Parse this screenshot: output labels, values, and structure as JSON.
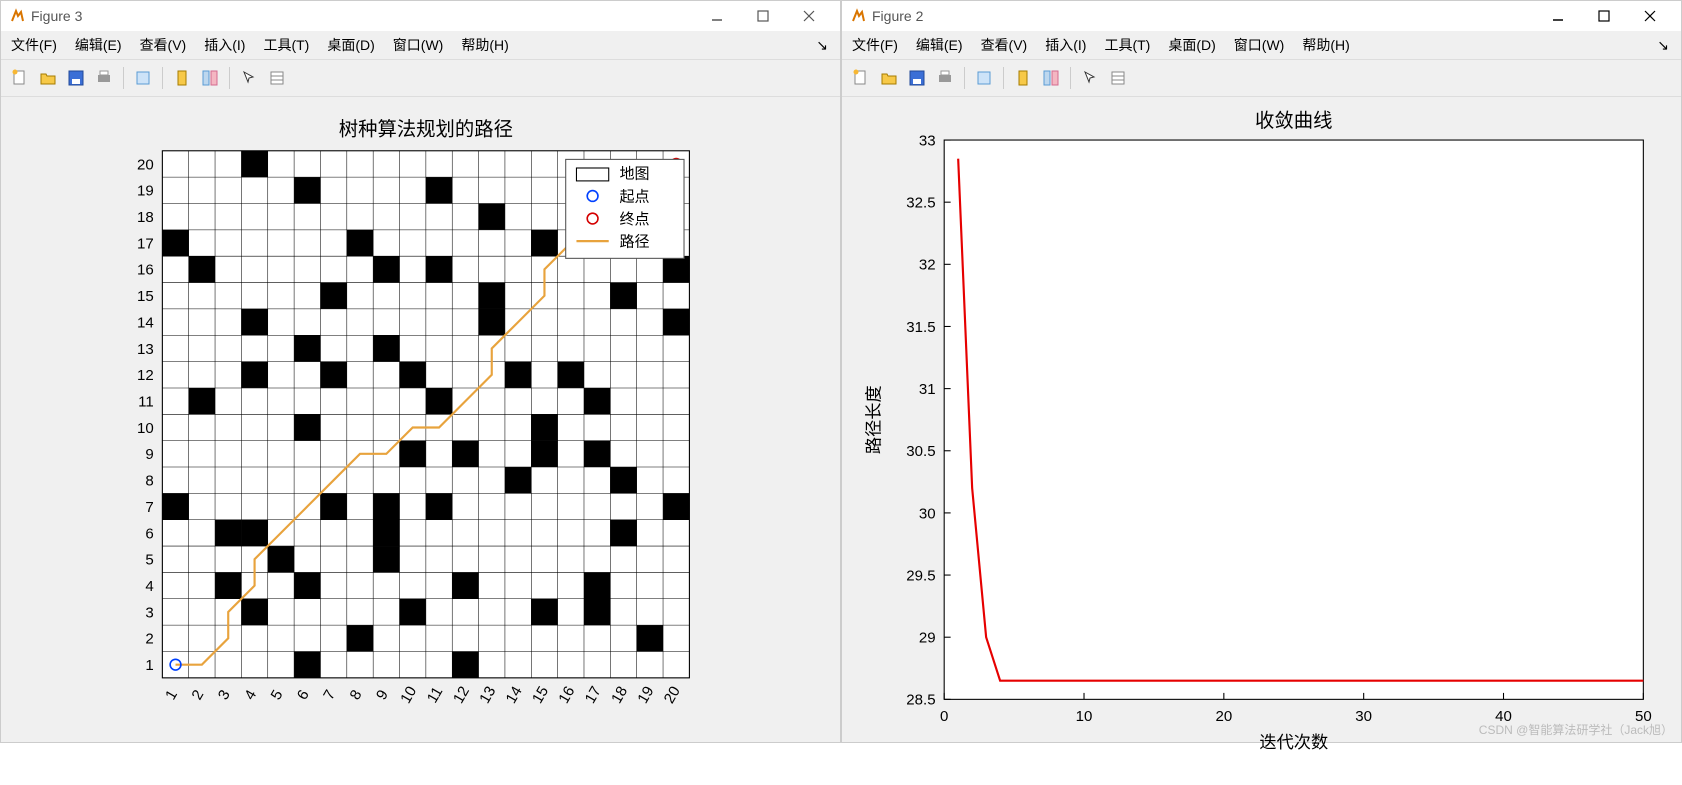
{
  "windows": [
    {
      "title": "Figure 3"
    },
    {
      "title": "Figure 2"
    }
  ],
  "menu": [
    "文件(F)",
    "编辑(E)",
    "查看(V)",
    "插入(I)",
    "工具(T)",
    "桌面(D)",
    "窗口(W)",
    "帮助(H)"
  ],
  "left": {
    "title": "树种算法规划的路径",
    "legend": [
      "地图",
      "起点",
      "终点",
      "路径"
    ],
    "xticks": [
      1,
      2,
      3,
      4,
      5,
      6,
      7,
      8,
      9,
      10,
      11,
      12,
      13,
      14,
      15,
      16,
      17,
      18,
      19,
      20
    ],
    "yticks": [
      1,
      2,
      3,
      4,
      5,
      6,
      7,
      8,
      9,
      10,
      11,
      12,
      13,
      14,
      15,
      16,
      17,
      18,
      19,
      20
    ]
  },
  "right": {
    "title": "收敛曲线",
    "xlabel": "迭代次数",
    "ylabel": "路径长度",
    "xticks": [
      0,
      10,
      20,
      30,
      40,
      50
    ],
    "yticks": [
      28.5,
      29,
      29.5,
      30,
      30.5,
      31,
      31.5,
      32,
      32.5,
      33
    ]
  },
  "watermark": "CSDN @智能算法研学社（Jack旭）",
  "chart_data": [
    {
      "type": "heatmap",
      "title": "树种算法规划的路径",
      "xlim": [
        0.5,
        20.5
      ],
      "ylim": [
        0.5,
        20.5
      ],
      "obstacles": [
        [
          1,
          7
        ],
        [
          1,
          17
        ],
        [
          2,
          11
        ],
        [
          2,
          16
        ],
        [
          3,
          4
        ],
        [
          3,
          6
        ],
        [
          4,
          3
        ],
        [
          4,
          6
        ],
        [
          4,
          12
        ],
        [
          4,
          14
        ],
        [
          4,
          20
        ],
        [
          5,
          5
        ],
        [
          6,
          1
        ],
        [
          6,
          4
        ],
        [
          6,
          10
        ],
        [
          6,
          13
        ],
        [
          6,
          19
        ],
        [
          7,
          7
        ],
        [
          7,
          12
        ],
        [
          7,
          15
        ],
        [
          8,
          2
        ],
        [
          8,
          17
        ],
        [
          9,
          5
        ],
        [
          9,
          6
        ],
        [
          9,
          7
        ],
        [
          9,
          13
        ],
        [
          9,
          16
        ],
        [
          10,
          3
        ],
        [
          10,
          9
        ],
        [
          10,
          12
        ],
        [
          11,
          7
        ],
        [
          11,
          11
        ],
        [
          11,
          16
        ],
        [
          11,
          19
        ],
        [
          12,
          1
        ],
        [
          12,
          4
        ],
        [
          12,
          9
        ],
        [
          13,
          14
        ],
        [
          13,
          15
        ],
        [
          13,
          18
        ],
        [
          14,
          8
        ],
        [
          14,
          12
        ],
        [
          15,
          3
        ],
        [
          15,
          9
        ],
        [
          15,
          10
        ],
        [
          15,
          17
        ],
        [
          16,
          12
        ],
        [
          17,
          3
        ],
        [
          17,
          4
        ],
        [
          17,
          9
        ],
        [
          17,
          11
        ],
        [
          18,
          6
        ],
        [
          18,
          8
        ],
        [
          18,
          15
        ],
        [
          18,
          19
        ],
        [
          19,
          2
        ],
        [
          19,
          18
        ],
        [
          20,
          7
        ],
        [
          20,
          14
        ],
        [
          20,
          16
        ]
      ],
      "path": [
        [
          1,
          1
        ],
        [
          2,
          1
        ],
        [
          3,
          2
        ],
        [
          3,
          3
        ],
        [
          4,
          4
        ],
        [
          4,
          5
        ],
        [
          5,
          6
        ],
        [
          6,
          7
        ],
        [
          7,
          8
        ],
        [
          8,
          9
        ],
        [
          9,
          9
        ],
        [
          10,
          10
        ],
        [
          11,
          10
        ],
        [
          12,
          11
        ],
        [
          13,
          12
        ],
        [
          13,
          13
        ],
        [
          14,
          14
        ],
        [
          15,
          15
        ],
        [
          15,
          16
        ],
        [
          16,
          17
        ],
        [
          17,
          18
        ],
        [
          18,
          18
        ],
        [
          19,
          19
        ],
        [
          20,
          20
        ]
      ],
      "start": [
        1,
        1
      ],
      "end": [
        20,
        20
      ],
      "legend": [
        "地图",
        "起点",
        "终点",
        "路径"
      ]
    },
    {
      "type": "line",
      "title": "收敛曲线",
      "xlabel": "迭代次数",
      "ylabel": "路径长度",
      "xlim": [
        0,
        50
      ],
      "ylim": [
        28.5,
        33
      ],
      "series": [
        {
          "name": "路径长度",
          "x": [
            1,
            2,
            3,
            4,
            5,
            6,
            7,
            8,
            9,
            10,
            15,
            20,
            25,
            30,
            35,
            40,
            45,
            50
          ],
          "y": [
            32.85,
            30.2,
            29.0,
            28.65,
            28.65,
            28.65,
            28.65,
            28.65,
            28.65,
            28.65,
            28.65,
            28.65,
            28.65,
            28.65,
            28.65,
            28.65,
            28.65,
            28.65
          ]
        }
      ]
    }
  ]
}
